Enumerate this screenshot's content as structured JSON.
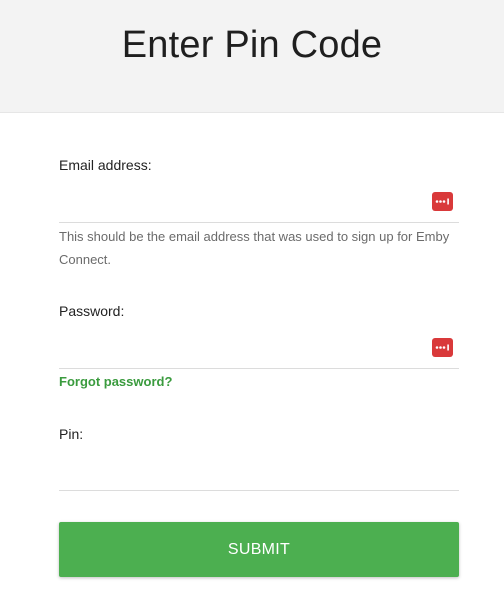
{
  "header": {
    "title": "Enter Pin Code"
  },
  "form": {
    "email": {
      "label": "Email address:",
      "value": "",
      "hint": "This should be the email address that was used to sign up for Emby Connect."
    },
    "password": {
      "label": "Password:",
      "value": "",
      "forgot_link": "Forgot password?"
    },
    "pin": {
      "label": "Pin:",
      "value": ""
    },
    "submit_label": "SUBMIT"
  },
  "icons": {
    "password_manager": "password-manager-icon"
  },
  "colors": {
    "header_bg": "#f3f3f3",
    "accent_green": "#4caf50",
    "link_green": "#3a9b3e",
    "pw_icon_red": "#d9393a"
  }
}
